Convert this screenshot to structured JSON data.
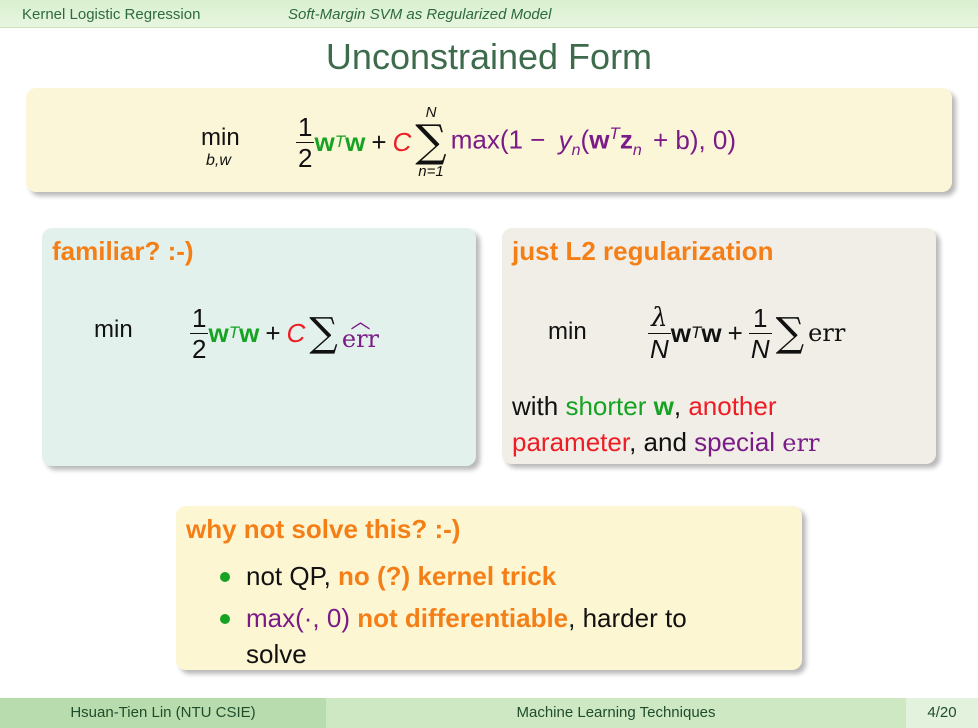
{
  "header": {
    "section": "Kernel Logistic Regression",
    "subsection": "Soft-Margin SVM as Regularized Model"
  },
  "title": "Unconstrained Form",
  "top_box": {
    "min": "min",
    "min_sub": "b,w",
    "frac_num": "1",
    "frac_den": "2",
    "w": "w",
    "T": "T",
    "plus": "+",
    "C": "C",
    "sum": "∑",
    "sum_top": "N",
    "sum_bottom": "n=1",
    "max_open": "max(1 −",
    "y": "y",
    "n_sub": "n",
    "paren_open": "(",
    "z": "z",
    "plus_b": "+ b), 0)"
  },
  "left_box": {
    "heading": "familiar? :-)",
    "min": "min",
    "frac_num": "1",
    "frac_den": "2",
    "w": "w",
    "T": "T",
    "plus": "+",
    "C": "C",
    "sum": "∑",
    "err": "err",
    "hat": "︿"
  },
  "right_box": {
    "heading": "just L2 regularization",
    "min": "min",
    "frac1_num": "λ",
    "frac1_den": "N",
    "w": "w",
    "T": "T",
    "plus": "+",
    "frac2_num": "1",
    "frac2_den": "N",
    "sum": "∑",
    "err": "err",
    "line1_a": "with ",
    "line1_b": "shorter ",
    "line1_c": "w",
    "line1_d": ", ",
    "line1_e": "another",
    "line2_a": "parameter",
    "line2_b": ", and ",
    "line2_c": "special ",
    "line2_d": "err"
  },
  "bottom_box": {
    "heading": "why not solve this? :-)",
    "b1_a": "not QP, ",
    "b1_b": "no (?) kernel trick",
    "b2_a": "max(·, 0) ",
    "b2_b": "not differentiable",
    "b2_c": ", harder to",
    "b2_d": "solve"
  },
  "footer": {
    "author": "Hsuan-Tien Lin  (NTU CSIE)",
    "course": "Machine Learning Techniques",
    "page": "4/20"
  },
  "colors": {
    "orange": "#f57f17",
    "green": "#16a323",
    "red": "#ee1c24",
    "purple": "#7b1b87",
    "title": "#3d6b4c"
  }
}
